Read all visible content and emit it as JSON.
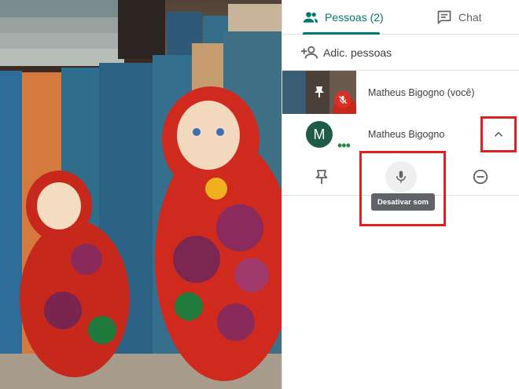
{
  "tabs": {
    "people_label": "Pessoas (2)",
    "chat_label": "Chat",
    "active": "people",
    "accent_color": "#00796b"
  },
  "add_people": {
    "label": "Adic. pessoas"
  },
  "participants": [
    {
      "name": "Matheus Bigogno (você)",
      "muted": true,
      "pinned_icon": "pin-icon"
    },
    {
      "name": "Matheus Bigogno",
      "avatar_initial": "M",
      "avatar_color": "#1e5c49"
    }
  ],
  "participant_actions": {
    "tooltip": "Desativar som",
    "icons": [
      "pin-icon",
      "microphone-icon",
      "remove-icon"
    ]
  },
  "highlight_color": "#e02020"
}
